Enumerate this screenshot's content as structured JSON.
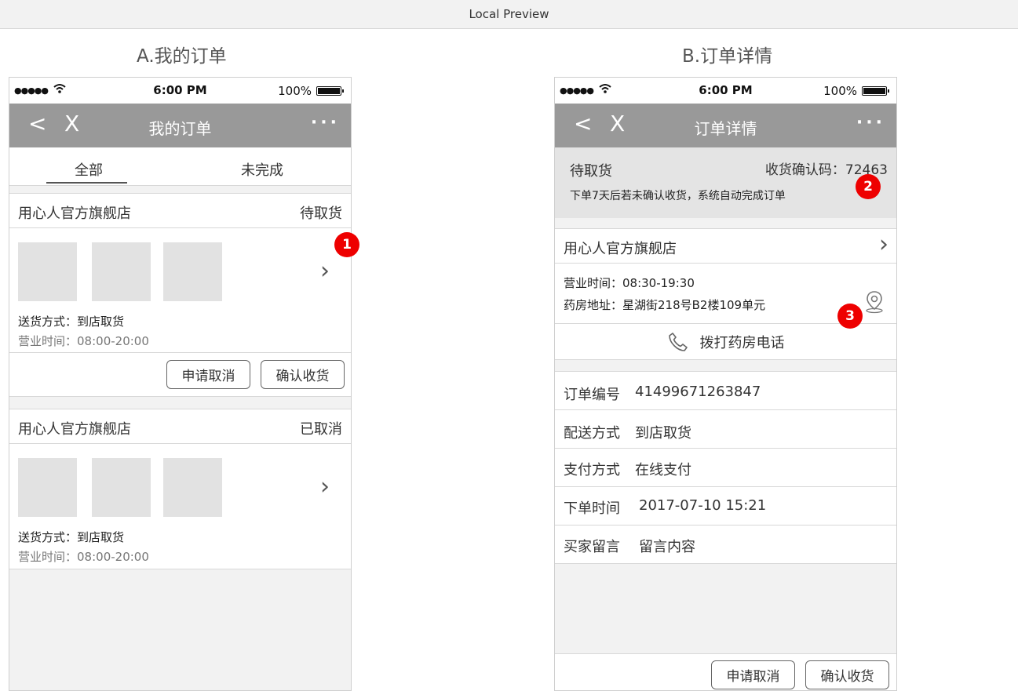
{
  "window_title": "Local Preview",
  "screen_a": {
    "heading": "A.我的订单",
    "status": {
      "time": "6:00 PM",
      "battery": "100%"
    },
    "nav": {
      "back": "<",
      "close": "X",
      "title": "我的订单",
      "more": "···"
    },
    "tabs": [
      {
        "label": "全部",
        "active": true
      },
      {
        "label": "未完成",
        "active": false
      }
    ],
    "orders": [
      {
        "store": "用心人官方旗舰店",
        "status": "待取货",
        "delivery_label": "送货方式：",
        "delivery_value": "到店取货",
        "hours_label": "营业时间：",
        "hours_value": "08:00-20:00",
        "buttons": {
          "cancel": "申请取消",
          "confirm": "确认收货"
        }
      },
      {
        "store": "用心人官方旗舰店",
        "status": "已取消",
        "delivery_label": "送货方式：",
        "delivery_value": "到店取货",
        "hours_label": "营业时间：",
        "hours_value": "08:00-20:00"
      }
    ],
    "badge_1": "1"
  },
  "screen_b": {
    "heading": "B.订单详情",
    "status": {
      "time": "6:00 PM",
      "battery": "100%"
    },
    "nav": {
      "back": "<",
      "close": "X",
      "title": "订单详情",
      "more": "···"
    },
    "state": {
      "label": "待取货",
      "code_label": "收货确认码：",
      "code_value": "72463",
      "note": "下单7天后若未确认收货，系统自动完成订单"
    },
    "store": {
      "name": "用心人官方旗舰店",
      "hours": "营业时间：08:30-19:30",
      "address": "药房地址：星湖街218号B2楼109单元",
      "call": "拨打药房电话"
    },
    "details": [
      {
        "label": "订单编号",
        "value": "41499671263847"
      },
      {
        "label": "配送方式",
        "value": "到店取货"
      },
      {
        "label": "支付方式",
        "value": "在线支付"
      },
      {
        "label": "下单时间",
        "value": "2017-07-10 15:21"
      },
      {
        "label": "买家留言",
        "value": "留言内容"
      }
    ],
    "buttons": {
      "cancel": "申请取消",
      "confirm": "确认收货"
    },
    "badge_2": "2",
    "badge_3": "3"
  }
}
